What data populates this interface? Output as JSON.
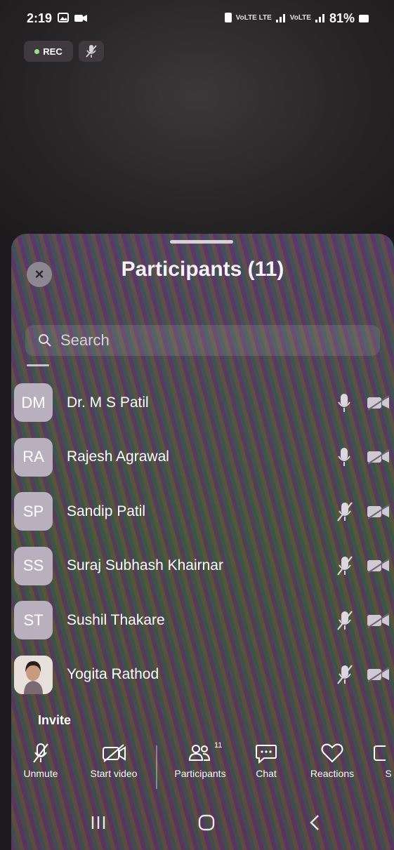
{
  "status_bar": {
    "time": "2:19",
    "network_1": "VoLTE LTE",
    "network_2": "VoLTE",
    "battery": "81%"
  },
  "meeting": {
    "rec_label": "REC"
  },
  "sheet": {
    "title": "Participants (11)",
    "search_placeholder": "Search",
    "participants": [
      {
        "initials": "DM",
        "name": "Dr. M S Patil",
        "mic": "on",
        "video": "off"
      },
      {
        "initials": "RA",
        "name": "Rajesh Agrawal",
        "mic": "on",
        "video": "off"
      },
      {
        "initials": "SP",
        "name": "Sandip Patil",
        "mic": "muted",
        "video": "off"
      },
      {
        "initials": "SS",
        "name": "Suraj Subhash Khairnar",
        "mic": "muted",
        "video": "off"
      },
      {
        "initials": "ST",
        "name": "Sushil Thakare",
        "mic": "muted",
        "video": "off"
      },
      {
        "initials": "",
        "name": "Yogita Rathod",
        "mic": "muted",
        "video": "off"
      }
    ],
    "invite_label": "Invite"
  },
  "toolbar": {
    "unmute": "Unmute",
    "start_video": "Start video",
    "participants": "Participants",
    "participants_count": "11",
    "chat": "Chat",
    "reactions": "Reactions",
    "share": "S"
  },
  "colors": {
    "avatar_bg": "#b8b0bd",
    "rec_dot": "#9de08a"
  }
}
